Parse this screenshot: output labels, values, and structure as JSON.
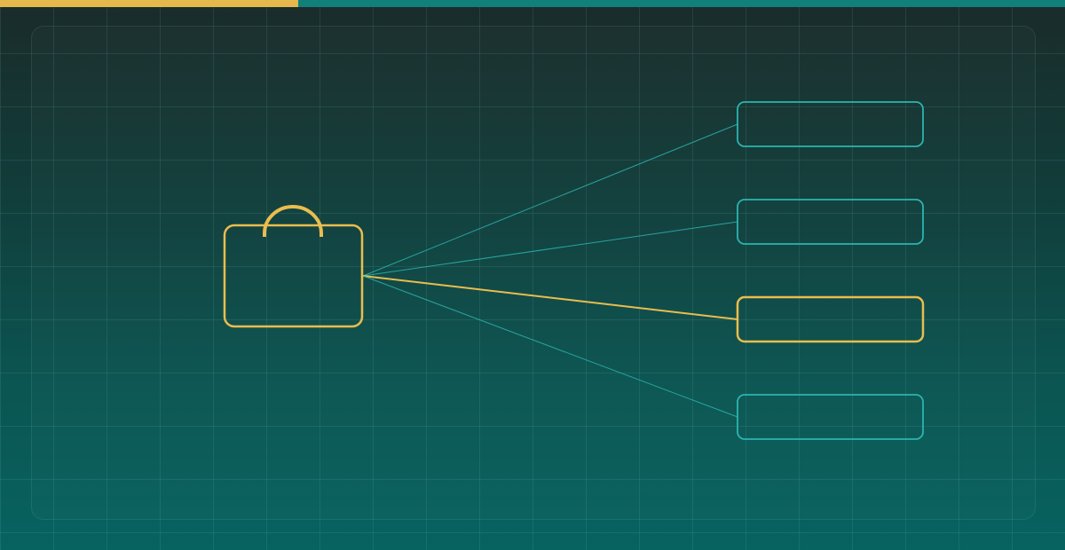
{
  "colors": {
    "accent": "#e9bd4e",
    "teal": "#2bb5b0",
    "top_bar_primary": "#e4b84c",
    "top_bar_secondary": "#11807a"
  },
  "top_bar": {
    "primary_fraction": 0.28
  },
  "hub": {
    "icon": "briefcase-icon"
  },
  "nodes": [
    {
      "id": "node-1",
      "highlighted": false,
      "label": ""
    },
    {
      "id": "node-2",
      "highlighted": false,
      "label": ""
    },
    {
      "id": "node-3",
      "highlighted": true,
      "label": ""
    },
    {
      "id": "node-4",
      "highlighted": false,
      "label": ""
    }
  ]
}
